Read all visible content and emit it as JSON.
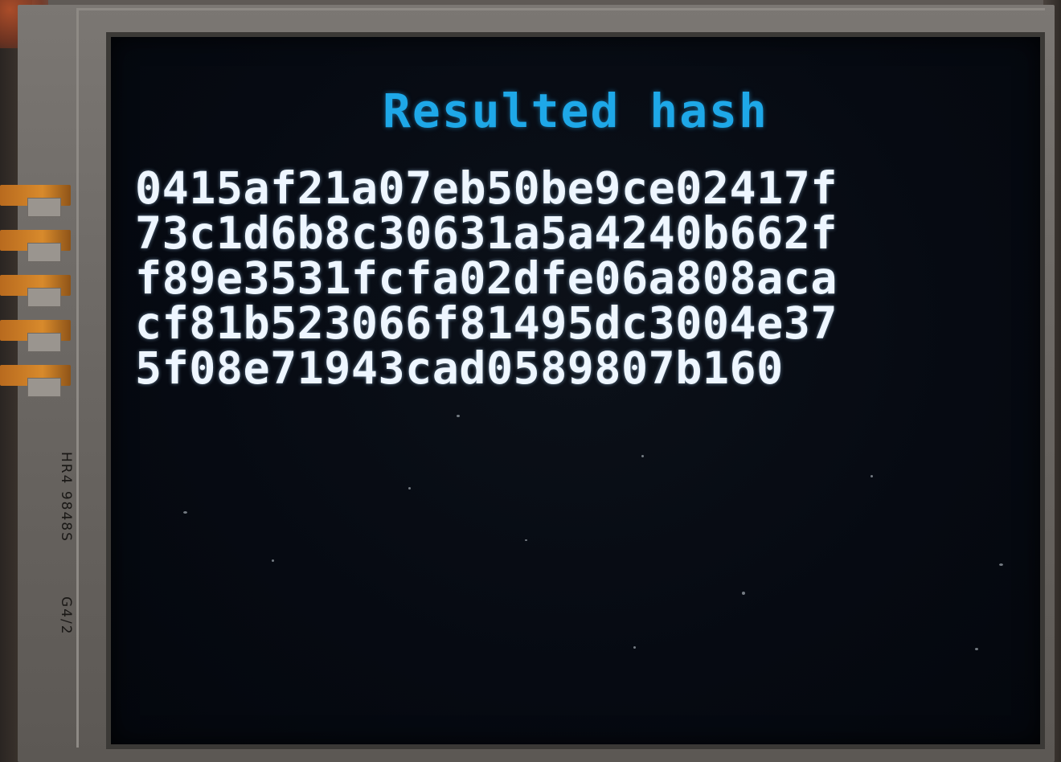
{
  "screen": {
    "title": "Resulted hash",
    "hash_lines": [
      "0415af21a07eb50be9ce02417f",
      "73c1d6b8c30631a5a4240b662f",
      "f89e3531fcfa02dfe06a808aca",
      "cf81b523066f81495dc3004e37",
      "5f08e71943cad0589807b160"
    ]
  },
  "module_silkscreen": {
    "label_1": "HR4 9848S",
    "label_2": "G4/2"
  },
  "colors": {
    "title_text": "#1ea8e8",
    "hash_text": "#eef6ff",
    "screen_background": "#060a12"
  }
}
